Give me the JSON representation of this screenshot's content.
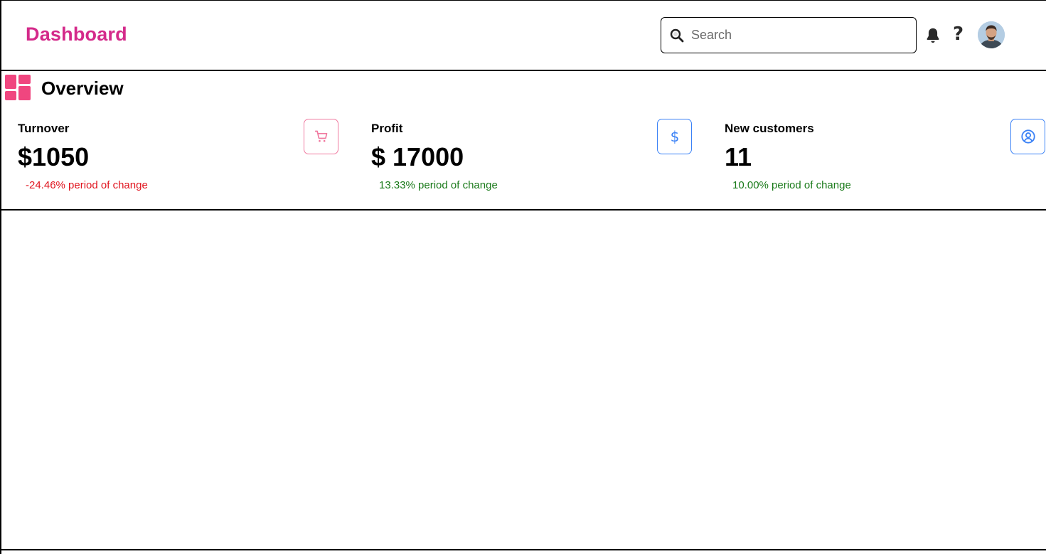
{
  "header": {
    "brand": "Dashboard",
    "brand_color": "#d42a8a",
    "search": {
      "placeholder": "Search",
      "value": ""
    },
    "icons": [
      "search-icon",
      "bell-icon",
      "help-icon",
      "avatar"
    ],
    "help_glyph": "?"
  },
  "overview": {
    "title": "Overview",
    "icon": "dashboard-layout-icon",
    "icon_color": "#f0467f",
    "cards": [
      {
        "label": "Turnover",
        "value": "$1050",
        "change": "-24.46% period of change",
        "trend": "negative",
        "icon": "cart-icon",
        "accent": "#f07aa0"
      },
      {
        "label": "Profit",
        "value": "$ 17000",
        "change": "13.33% period of change",
        "trend": "positive",
        "icon": "dollar-icon",
        "accent": "#3b82f6"
      },
      {
        "label": "New customers",
        "value": "11",
        "change": "10.00% period of change",
        "trend": "positive",
        "icon": "user-circle-icon",
        "accent": "#3b82f6"
      }
    ]
  },
  "colors": {
    "negative": "#e0141e",
    "positive": "#1a7a1a"
  }
}
